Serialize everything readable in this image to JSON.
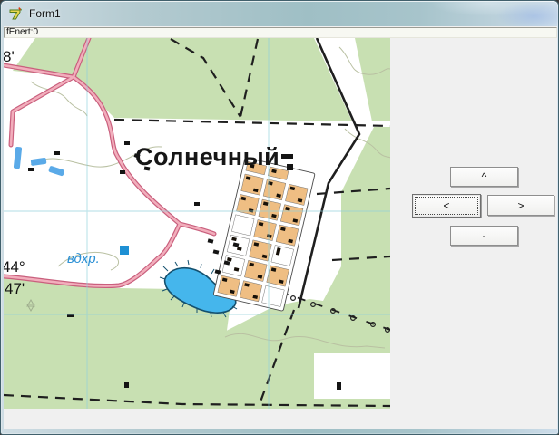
{
  "window": {
    "title": "Form1"
  },
  "statusbar": {
    "text": "fEnert:0"
  },
  "map_labels": {
    "settlement": "Солнечный",
    "reservoir": "вдхр.",
    "lat_deg": "44°",
    "lat_min": "47'",
    "edge_min": "8'"
  },
  "nav_buttons": {
    "up": "^",
    "left": "<",
    "right": ">",
    "down": "-"
  },
  "colors": {
    "forest_green": "#c8e0b2",
    "water_blue": "#45b6ec",
    "road_core_pink": "#f2aebc",
    "road_casing": "#c95f7d",
    "village_orange": "#efbe83",
    "grid_cyan": "#8fd0dc",
    "form_bg": "#f0f0f0",
    "titlebar_glass": "#a7c4cb"
  }
}
